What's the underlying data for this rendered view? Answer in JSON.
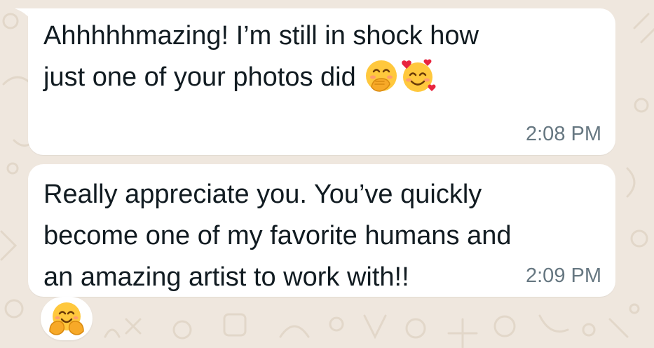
{
  "chat": {
    "messages": [
      {
        "lines": [
          "Ahhhhhmazing! I’m still in shock how",
          "just one of your photos did"
        ],
        "emojis": [
          "hand-over-mouth-emoji",
          "smiling-face-with-hearts-emoji"
        ],
        "time": "2:08 PM"
      },
      {
        "lines": [
          "Really appreciate you. You’ve quickly",
          "become one of my favorite humans and",
          "an amazing artist to work with!!"
        ],
        "time": "2:09 PM"
      }
    ],
    "reaction": {
      "emoji": "hugging-face-emoji"
    }
  },
  "colors": {
    "wallpaper": "#efe7de",
    "bubble": "#ffffff",
    "text": "#111b21",
    "timestamp": "#667781",
    "emoji_face": "#ffc83d"
  }
}
